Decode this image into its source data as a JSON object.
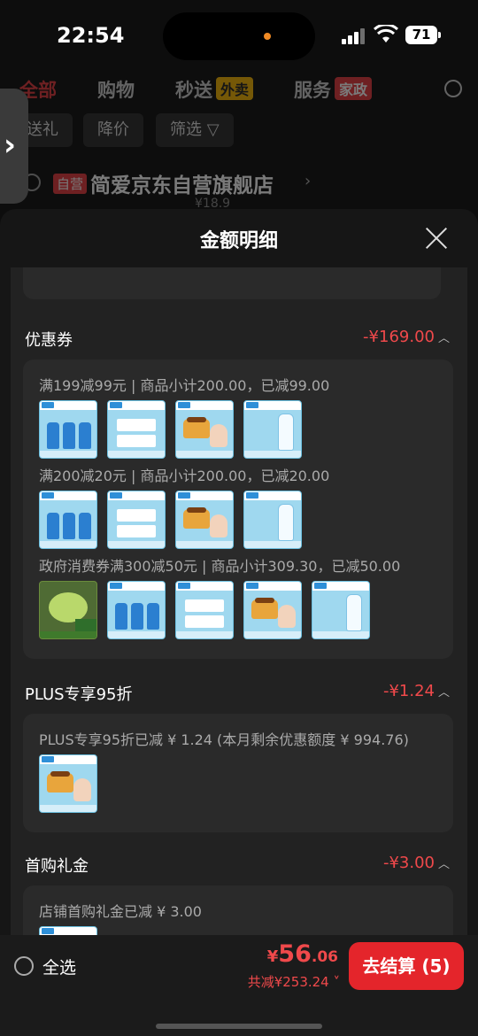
{
  "status_bar": {
    "time": "22:54",
    "battery": "71"
  },
  "nav": {
    "tabs": [
      {
        "label": "全部",
        "badge": ""
      },
      {
        "label": "购物",
        "badge": ""
      },
      {
        "label": "秒送",
        "badge": "外卖"
      },
      {
        "label": "服务",
        "badge": "家政"
      }
    ],
    "filters": [
      "送礼",
      "降价",
      "筛选"
    ]
  },
  "shop": {
    "self_tag": "自营",
    "name": "简爱京东自营旗舰店",
    "price_peek": "¥18.9"
  },
  "sheet": {
    "title": "金额明细",
    "sections": [
      {
        "title": "优惠券",
        "amount": "-¥169.00",
        "lines": [
          "满199减99元 | 商品小计200.00，已减99.00",
          "满200减20元 | 商品小计200.00，已减20.00",
          "政府消费券满300减50元 | 商品小计309.30，已减50.00"
        ]
      },
      {
        "title": "PLUS专享95折",
        "amount": "-¥1.24",
        "lines": [
          "PLUS专享95折已减 ¥ 1.24 (本月剩余优惠额度 ¥ 994.76)"
        ]
      },
      {
        "title": "首购礼金",
        "amount": "-¥3.00",
        "lines": [
          "店铺首购礼金已减 ¥ 3.00"
        ]
      }
    ]
  },
  "bottom": {
    "select_all": "全选",
    "total_currency": "¥",
    "total_int": "56",
    "total_dec": ".06",
    "saved": "共减¥253.24",
    "checkout": "去结算 (5)"
  }
}
